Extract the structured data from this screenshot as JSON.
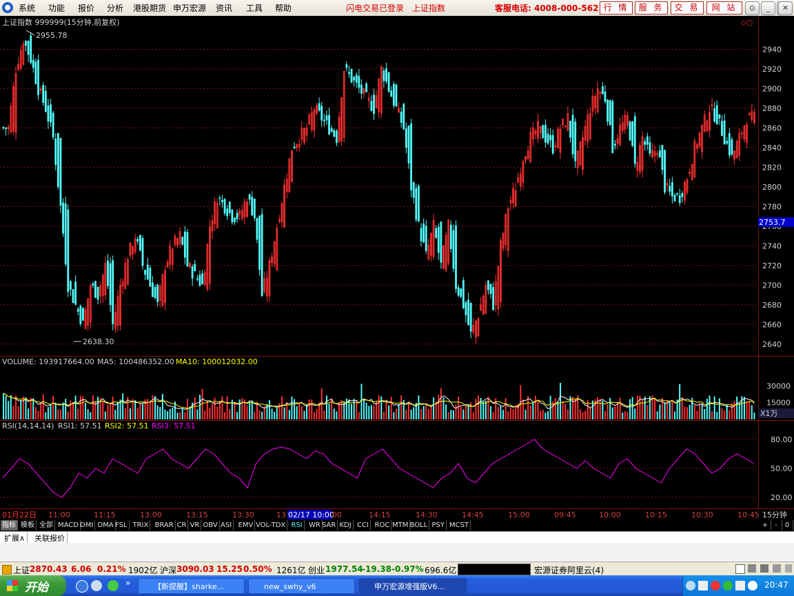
{
  "menu": {
    "items": [
      "系统",
      "功能",
      "报价",
      "分析",
      "港股期货",
      "申万宏源",
      "资讯",
      "工具",
      "帮助"
    ],
    "flash_login": "闪电交易已登录",
    "index_name": "上证指数",
    "hotline": "客服电话: 4008-000-562",
    "buttons": [
      "行 情",
      "服 务",
      "交 易",
      "网 站"
    ],
    "window_controls": [
      "⊙",
      "_",
      "▭",
      "✕"
    ]
  },
  "price_panel": {
    "header": "上证指数 999999(15分钟,前复权)",
    "high_label": "2955.78",
    "low_label": "2638.30",
    "current_tag": "2753.7",
    "y_ticks": [
      "2940",
      "2920",
      "2900",
      "2880",
      "2860",
      "2840",
      "2820",
      "2800",
      "2780",
      "2760",
      "2740",
      "2720",
      "2700",
      "2680",
      "2660",
      "2640"
    ]
  },
  "volume_panel": {
    "label_vol": "VOLUME: 193917664.00",
    "label_ma5": "MA5: 100486352.00",
    "label_ma10": "MA10: 100012032.00",
    "y_ticks": [
      "30000",
      "15000"
    ],
    "unit_tag": "X1万"
  },
  "rsi_panel": {
    "label_name": "RSI(14,14,14)",
    "label_rsi1": "RSI1: 57.51",
    "label_rsi2": "RSI2: 57.51",
    "label_rsi3": "RSI3: 57.51",
    "y_ticks": [
      "80.00",
      "50.00",
      "20.00"
    ]
  },
  "time_axis": {
    "labels": [
      "01月22日",
      "11:00",
      "11:15",
      "13:00",
      "13:15",
      "13:30",
      "13",
      "02/17 10:00",
      "00",
      "14:15",
      "14:30",
      "14:45",
      "15:00",
      "09:45",
      "10:00",
      "10:15",
      "10:30",
      "10:45"
    ],
    "period": "15分钟"
  },
  "indicator_tabs": [
    "指标",
    "模板",
    "全部",
    "MACD",
    "DMI",
    "DMA",
    "FSL",
    "TRIX",
    "BRAR",
    "CR",
    "VR",
    "OBV",
    "ASI",
    "EMV",
    "VOL-TDX",
    "RSI",
    "WR",
    "SAR",
    "KDJ",
    "CCI",
    "ROC",
    "MTM",
    "BOLL",
    "PSY",
    "MCST"
  ],
  "tab_controls": [
    "+",
    "-",
    "0"
  ],
  "ext_tabs": [
    "扩展∧",
    "关联报价"
  ],
  "status": {
    "sh_label": "上证",
    "sh_value": "2870.43",
    "sh_change": "6.06",
    "sh_pct": "0.21%",
    "sh_amount": "1902亿",
    "hs_label": "沪深",
    "hs_value": "3090.03",
    "hs_change": "15.25",
    "hs_pct": "0.50%",
    "hs_amount": "1261亿",
    "cy_label": "创业",
    "cy_value": "1977.54",
    "cy_change": "-19.38",
    "cy_pct": "-0.97%",
    "cy_amount": "696.6亿",
    "server": "宏源证券阿里云(4)"
  },
  "taskbar": {
    "start": "开始",
    "tasks": [
      "【新提醒】sharke...",
      "new_swhy_v6",
      "申万宏源增强版V6..."
    ],
    "clock": "20:47"
  },
  "colors": {
    "up": "#ff3232",
    "down": "#54fcfc",
    "rsi": "#ff00ff",
    "ma5": "#ffffff",
    "ma10": "#ffff00",
    "grid": "#841010"
  },
  "chart_data": {
    "type": "candlestick",
    "title": "上证指数 999999(15分钟,前复权)",
    "price_range": [
      2630,
      2960
    ],
    "high": 2955.78,
    "low": 2638.3,
    "last": 2870.43,
    "series_close_approx": [
      2860,
      2920,
      2950,
      2930,
      2900,
      2880,
      2850,
      2780,
      2700,
      2680,
      2660,
      2700,
      2690,
      2720,
      2660,
      2700,
      2730,
      2750,
      2720,
      2700,
      2680,
      2720,
      2740,
      2750,
      2720,
      2710,
      2700,
      2760,
      2790,
      2780,
      2770,
      2770,
      2790,
      2770,
      2690,
      2720,
      2760,
      2800,
      2840,
      2850,
      2860,
      2880,
      2870,
      2860,
      2850,
      2920,
      2910,
      2900,
      2890,
      2880,
      2920,
      2900,
      2880,
      2860,
      2800,
      2760,
      2730,
      2760,
      2720,
      2760,
      2700,
      2680,
      2650,
      2670,
      2700,
      2680,
      2740,
      2780,
      2800,
      2830,
      2850,
      2860,
      2850,
      2840,
      2860,
      2870,
      2820,
      2850,
      2880,
      2900,
      2890,
      2840,
      2860,
      2870,
      2820,
      2850,
      2830,
      2840,
      2800,
      2790,
      2790,
      2810,
      2840,
      2860,
      2880,
      2870,
      2850,
      2830,
      2850,
      2870,
      2870
    ],
    "volume_range": [
      0,
      40000
    ],
    "rsi_range": [
      10,
      90
    ],
    "rsi_approx": [
      40,
      50,
      60,
      55,
      45,
      35,
      25,
      20,
      30,
      45,
      40,
      50,
      45,
      60,
      55,
      50,
      45,
      60,
      65,
      70,
      60,
      55,
      50,
      60,
      70,
      65,
      55,
      45,
      40,
      30,
      55,
      65,
      70,
      72,
      70,
      65,
      60,
      68,
      65,
      55,
      50,
      45,
      40,
      60,
      65,
      70,
      60,
      50,
      45,
      40,
      35,
      30,
      40,
      45,
      55,
      40,
      35,
      45,
      55,
      60,
      65,
      70,
      75,
      80,
      70,
      65,
      60,
      55,
      50,
      58,
      50,
      45,
      40,
      55,
      60,
      50,
      45,
      40,
      35,
      50,
      60,
      70,
      65,
      55,
      45,
      50,
      60,
      65,
      60,
      55
    ]
  }
}
